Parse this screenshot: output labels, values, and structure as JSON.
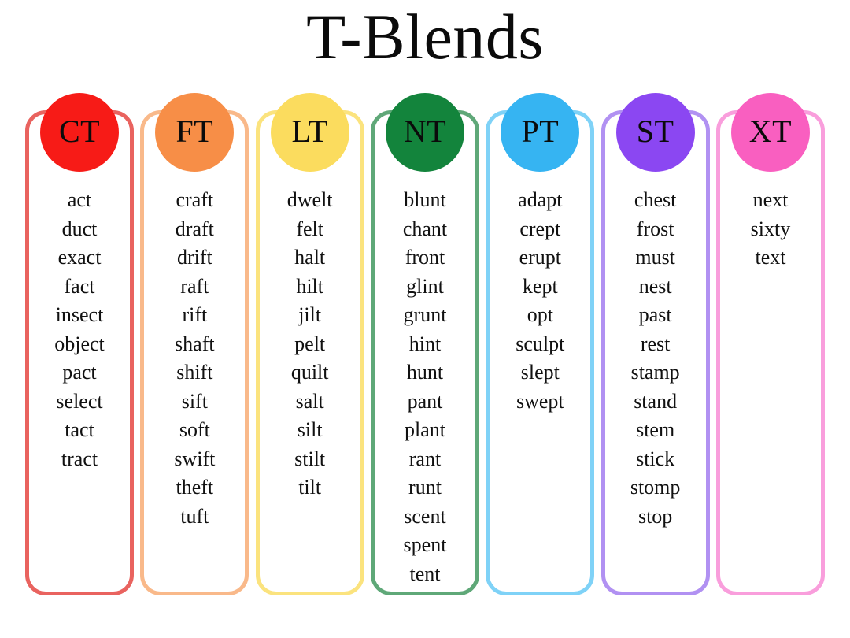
{
  "poster": {
    "title": "T-Blends",
    "background_color": "#FFFFFF",
    "text_color": "#111111"
  },
  "columns": [
    {
      "id": "ct",
      "label": "CT",
      "circle_color": "#F71B17",
      "border_color": "#E9635F",
      "words": [
        "act",
        "duct",
        "exact",
        "fact",
        "insect",
        "object",
        "pact",
        "select",
        "tact",
        "tract"
      ]
    },
    {
      "id": "ft",
      "label": "FT",
      "circle_color": "#F78E47",
      "border_color": "#F9B98A",
      "words": [
        "craft",
        "draft",
        "drift",
        "raft",
        "rift",
        "shaft",
        "shift",
        "sift",
        "soft",
        "swift",
        "theft",
        "tuft"
      ]
    },
    {
      "id": "lt",
      "label": "LT",
      "circle_color": "#FBDC5E",
      "border_color": "#FBE37E",
      "words": [
        "dwelt",
        "felt",
        "halt",
        "hilt",
        "jilt",
        "pelt",
        "quilt",
        "salt",
        "silt",
        "stilt",
        "tilt"
      ]
    },
    {
      "id": "nt",
      "label": "NT",
      "circle_color": "#13843C",
      "border_color": "#5FA878",
      "words": [
        "blunt",
        "chant",
        "front",
        "glint",
        "grunt",
        "hint",
        "hunt",
        "pant",
        "plant",
        "rant",
        "runt",
        "scent",
        "spent",
        "tent"
      ]
    },
    {
      "id": "pt",
      "label": "PT",
      "circle_color": "#36B4F2",
      "border_color": "#7FD2F7",
      "words": [
        "adapt",
        "crept",
        "erupt",
        "kept",
        "opt",
        "sculpt",
        "slept",
        "swept"
      ]
    },
    {
      "id": "st",
      "label": "ST",
      "circle_color": "#8B47F2",
      "border_color": "#B191F2",
      "words": [
        "chest",
        "frost",
        "must",
        "nest",
        "past",
        "rest",
        "stamp",
        "stand",
        "stem",
        "stick",
        "stomp",
        "stop"
      ]
    },
    {
      "id": "xt",
      "label": "XT",
      "circle_color": "#F95FC0",
      "border_color": "#F99EDC",
      "words": [
        "next",
        "sixty",
        "text"
      ]
    }
  ]
}
